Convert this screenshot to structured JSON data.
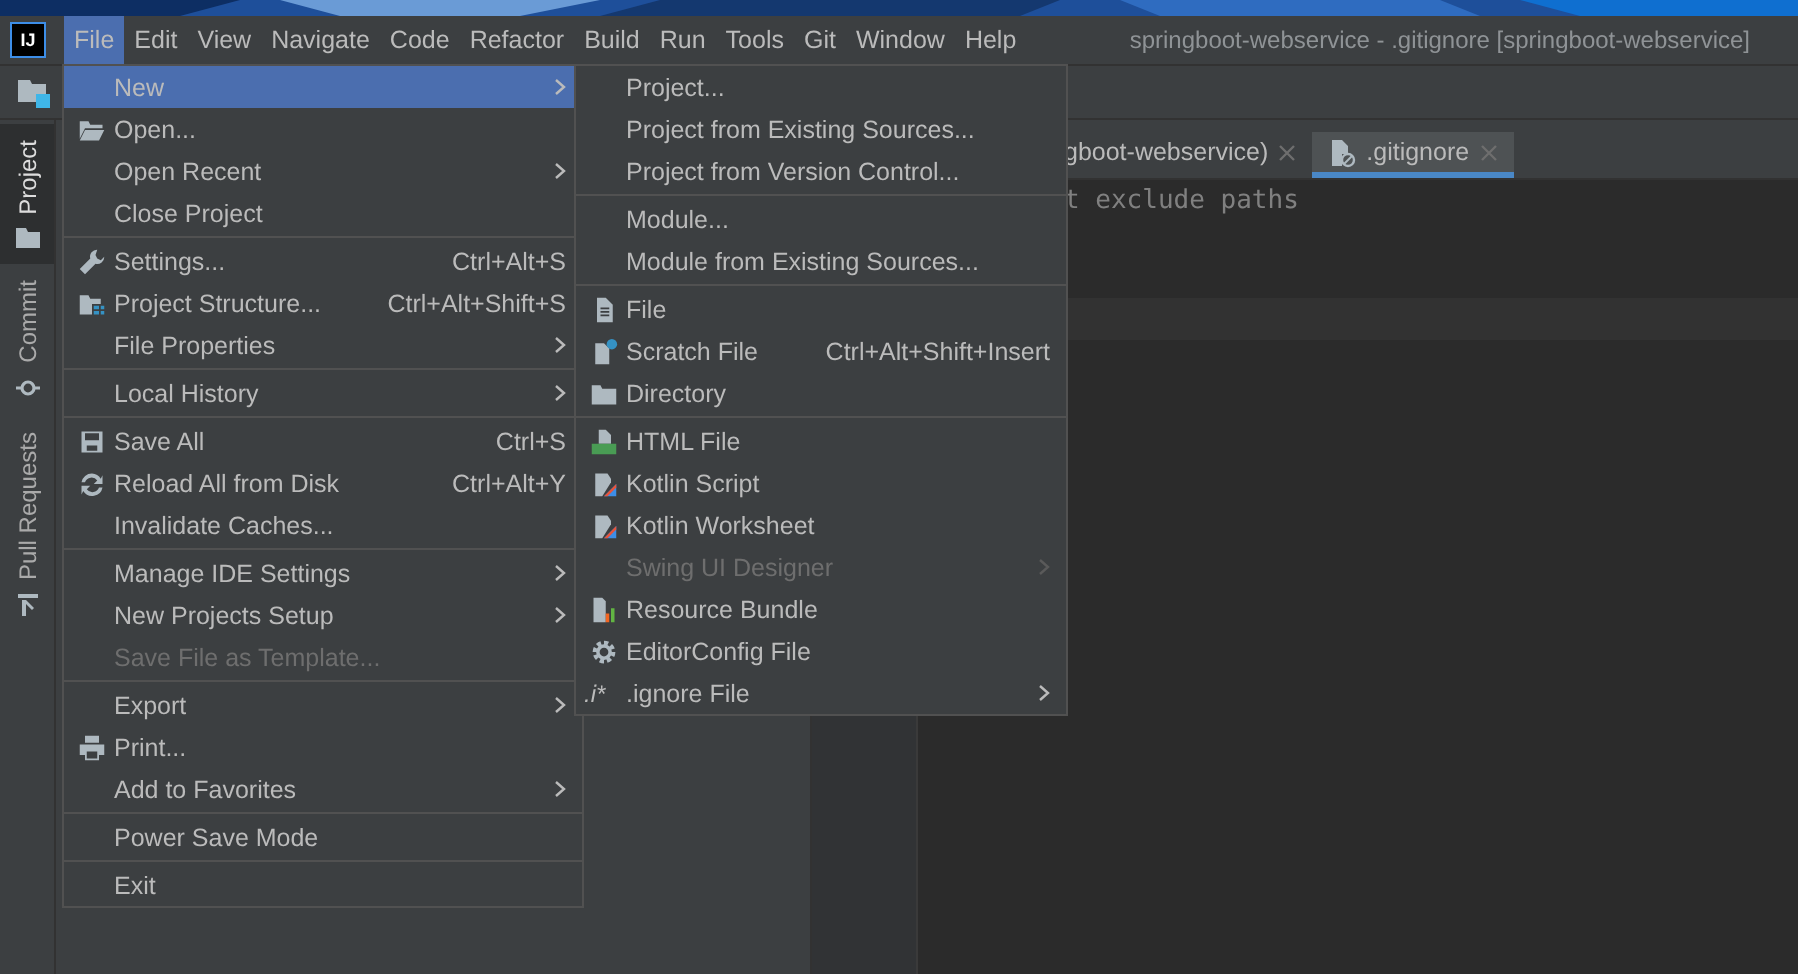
{
  "window": {
    "title": "springboot-webservice - .gitignore [springboot-webservice]",
    "logo_text": "IJ"
  },
  "menubar": [
    {
      "label": "File",
      "selected": true
    },
    {
      "label": "Edit",
      "selected": false
    },
    {
      "label": "View",
      "selected": false
    },
    {
      "label": "Navigate",
      "selected": false
    },
    {
      "label": "Code",
      "selected": false
    },
    {
      "label": "Refactor",
      "selected": false
    },
    {
      "label": "Build",
      "selected": false
    },
    {
      "label": "Run",
      "selected": false
    },
    {
      "label": "Tools",
      "selected": false
    },
    {
      "label": "Git",
      "selected": false
    },
    {
      "label": "Window",
      "selected": false
    },
    {
      "label": "Help",
      "selected": false
    }
  ],
  "tool_strip": [
    {
      "label": "Project",
      "selected": true
    },
    {
      "label": "Commit",
      "selected": false
    },
    {
      "label": "Pull Requests",
      "selected": false
    }
  ],
  "editor_tabs": [
    {
      "label": "gboot-webservice)",
      "selected": false
    },
    {
      "label": ".gitignore",
      "selected": true
    }
  ],
  "editor_lines": [
    "t exclude paths"
  ],
  "file_menu": [
    [
      {
        "label": "New",
        "selected": true,
        "submenu": true,
        "disabled": false
      },
      {
        "label": "Open...",
        "selected": false,
        "submenu": false,
        "disabled": false
      },
      {
        "label": "Open Recent",
        "selected": false,
        "submenu": true,
        "disabled": false
      },
      {
        "label": "Close Project",
        "selected": false,
        "submenu": false,
        "disabled": false
      }
    ],
    [
      {
        "label": "Settings...",
        "shortcut": "Ctrl+Alt+S",
        "selected": false,
        "submenu": false,
        "disabled": false
      },
      {
        "label": "Project Structure...",
        "shortcut": "Ctrl+Alt+Shift+S",
        "selected": false,
        "submenu": false,
        "disabled": false
      },
      {
        "label": "File Properties",
        "selected": false,
        "submenu": true,
        "disabled": false
      }
    ],
    [
      {
        "label": "Local History",
        "selected": false,
        "submenu": true,
        "disabled": false
      }
    ],
    [
      {
        "label": "Save All",
        "shortcut": "Ctrl+S",
        "selected": false,
        "submenu": false,
        "disabled": false
      },
      {
        "label": "Reload All from Disk",
        "shortcut": "Ctrl+Alt+Y",
        "selected": false,
        "submenu": false,
        "disabled": false
      },
      {
        "label": "Invalidate Caches...",
        "selected": false,
        "submenu": false,
        "disabled": false
      }
    ],
    [
      {
        "label": "Manage IDE Settings",
        "selected": false,
        "submenu": true,
        "disabled": false
      },
      {
        "label": "New Projects Setup",
        "selected": false,
        "submenu": true,
        "disabled": false
      },
      {
        "label": "Save File as Template...",
        "selected": false,
        "submenu": false,
        "disabled": true
      }
    ],
    [
      {
        "label": "Export",
        "selected": false,
        "submenu": true,
        "disabled": false
      },
      {
        "label": "Print...",
        "selected": false,
        "submenu": false,
        "disabled": false
      },
      {
        "label": "Add to Favorites",
        "selected": false,
        "submenu": true,
        "disabled": false
      }
    ],
    [
      {
        "label": "Power Save Mode",
        "selected": false,
        "submenu": false,
        "disabled": false
      }
    ],
    [
      {
        "label": "Exit",
        "selected": false,
        "submenu": false,
        "disabled": false
      }
    ]
  ],
  "new_submenu": [
    [
      {
        "label": "Project...",
        "selected": false,
        "submenu": false,
        "disabled": false
      },
      {
        "label": "Project from Existing Sources...",
        "selected": false,
        "submenu": false,
        "disabled": false
      },
      {
        "label": "Project from Version Control...",
        "selected": false,
        "submenu": false,
        "disabled": false
      }
    ],
    [
      {
        "label": "Module...",
        "selected": false,
        "submenu": false,
        "disabled": false
      },
      {
        "label": "Module from Existing Sources...",
        "selected": false,
        "submenu": false,
        "disabled": false
      }
    ],
    [
      {
        "label": "File",
        "selected": false,
        "submenu": false,
        "disabled": false
      },
      {
        "label": "Scratch File",
        "shortcut": "Ctrl+Alt+Shift+Insert",
        "selected": false,
        "submenu": false,
        "disabled": false
      },
      {
        "label": "Directory",
        "selected": false,
        "submenu": false,
        "disabled": false
      }
    ],
    [
      {
        "label": "HTML File",
        "selected": false,
        "submenu": false,
        "disabled": false
      },
      {
        "label": "Kotlin Script",
        "selected": false,
        "submenu": false,
        "disabled": false
      },
      {
        "label": "Kotlin Worksheet",
        "selected": false,
        "submenu": false,
        "disabled": false
      },
      {
        "label": "Swing UI Designer",
        "selected": false,
        "submenu": true,
        "disabled": true
      },
      {
        "label": "Resource Bundle",
        "selected": false,
        "submenu": false,
        "disabled": false
      },
      {
        "label": "EditorConfig File",
        "selected": false,
        "submenu": false,
        "disabled": false
      },
      {
        "label": ".ignore File",
        "icon_text": ".i*",
        "selected": false,
        "submenu": true,
        "disabled": false
      }
    ]
  ]
}
